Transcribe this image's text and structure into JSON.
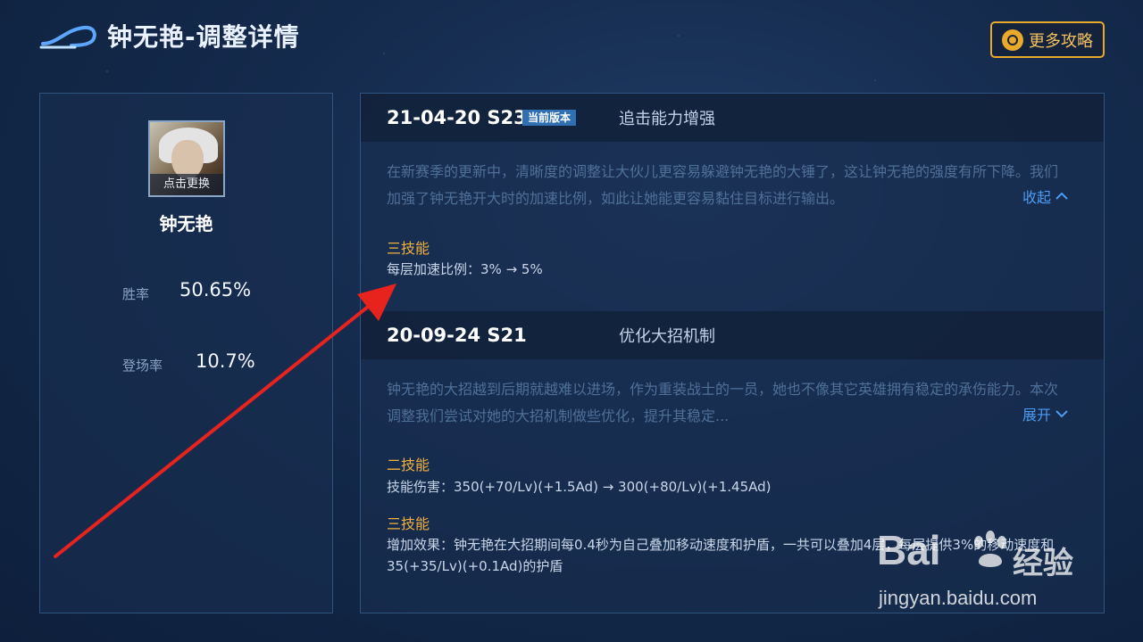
{
  "header": {
    "title": "钟无艳-调整详情",
    "more_label": "更多攻略"
  },
  "hero": {
    "avatar_caption": "点击更换",
    "name": "钟无艳",
    "stats": [
      {
        "label": "胜率",
        "value": "50.65%"
      },
      {
        "label": "登场率",
        "value": "10.7%"
      }
    ]
  },
  "versions": [
    {
      "date": "21-04-20  S23",
      "badge": "当前版本",
      "title": "追击能力增强",
      "description": "在新赛季的更新中，清晰度的调整让大伙儿更容易躲避钟无艳的大锤了，这让钟无艳的强度有所下降。我们加强了钟无艳开大时的加速比例，如此让她能更容易黏住目标进行输出。",
      "toggle": "收起",
      "skills": [
        {
          "title": "三技能",
          "text": "每层加速比例：3% → 5%"
        }
      ]
    },
    {
      "date": "20-09-24  S21",
      "title": "优化大招机制",
      "description": "钟无艳的大招越到后期就越难以进场，作为重装战士的一员，她也不像其它英雄拥有稳定的承伤能力。本次调整我们尝试对她的大招机制做些优化，提升其稳定...",
      "toggle": "展开",
      "skills": [
        {
          "title": "二技能",
          "text": "技能伤害：350(+70/Lv)(+1.5Ad) → 300(+80/Lv)(+1.45Ad)"
        },
        {
          "title": "三技能",
          "text": "增加效果：钟无艳在大招期间每0.4秒为自己叠加移动速度和护盾，一共可以叠加4层，每层提供3%的移动速度和35(+35/Lv)(+0.1Ad)的护盾"
        }
      ]
    }
  ],
  "watermark": {
    "brand": "Bai",
    "brand_cn": "经验",
    "url": "jingyan.baidu.com"
  },
  "colors": {
    "accent_gold": "#e9a92b",
    "skill_title": "#f0b03d",
    "link_blue": "#4c9bf0",
    "annotation_red": "#e8231d"
  }
}
